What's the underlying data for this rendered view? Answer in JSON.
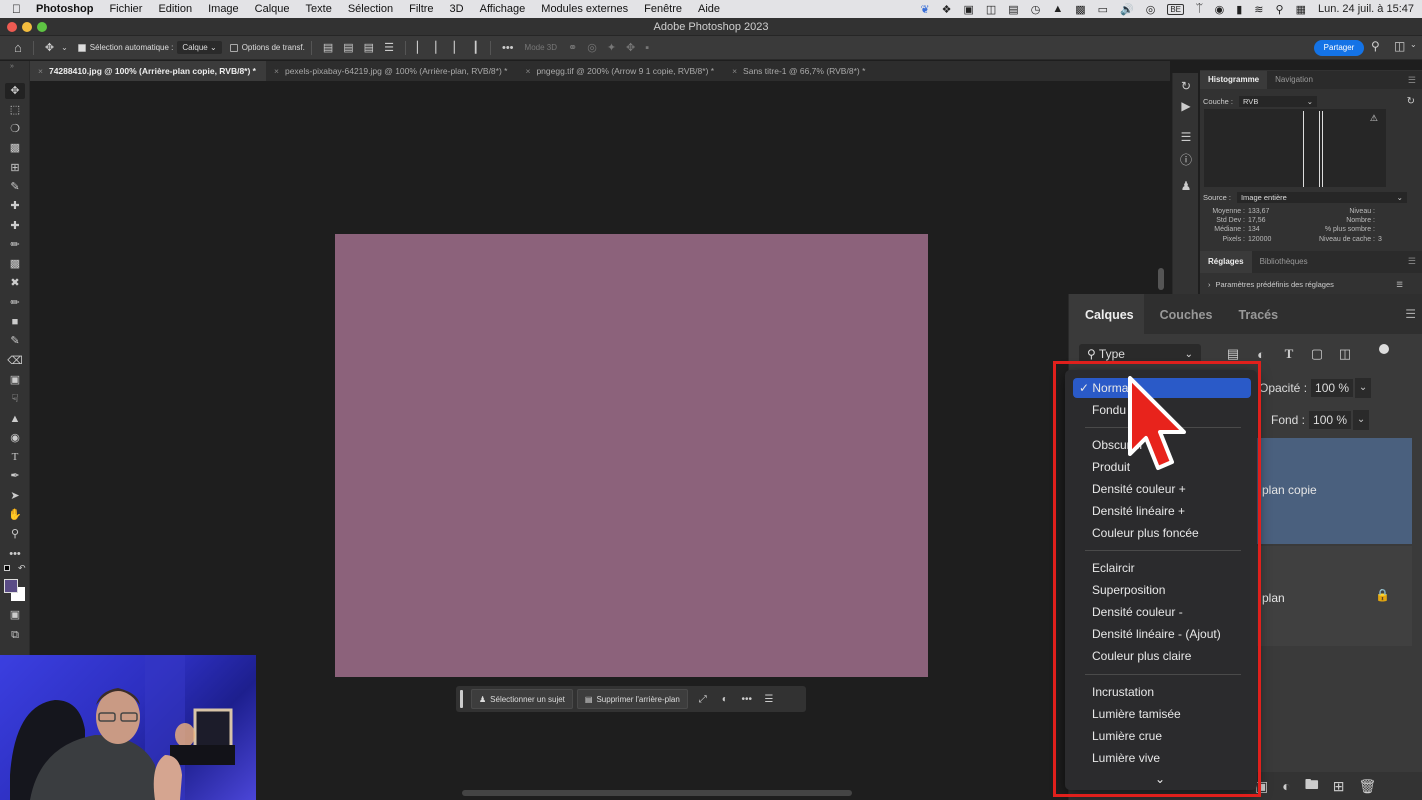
{
  "os_menubar": {
    "app_name": "Photoshop",
    "items": [
      "Fichier",
      "Edition",
      "Image",
      "Calque",
      "Texte",
      "Sélection",
      "Filtre",
      "3D",
      "Affichage",
      "Modules externes",
      "Fenêtre",
      "Aide"
    ],
    "status_icons": [
      "butterfly-icon",
      "dropbox-icon",
      "camera-icon",
      "window-icon",
      "clipboard-icon",
      "clock-icon",
      "binoculars-icon",
      "grid-icon",
      "display-icon",
      "volume-icon",
      "airdrop-icon",
      "keyboard-layout-icon",
      "bluetooth-icon",
      "user-icon",
      "battery-icon",
      "wifi-icon",
      "search-icon",
      "control-center-icon"
    ],
    "keyboard_layout": "BE",
    "datetime": "Lun. 24 juil. à 15:47"
  },
  "window": {
    "title": "Adobe Photoshop 2023",
    "traffic_colors": {
      "close": "#ee5b52",
      "minimize": "#f4bd3e",
      "zoom": "#5ec443"
    }
  },
  "options_bar": {
    "auto_select_label": "Sélection automatique :",
    "auto_select_checked": true,
    "auto_select_target": "Calque",
    "transform_label": "Options de transf.",
    "transform_checked": false,
    "mode_3d_label": "Mode 3D",
    "share_label": "Partager",
    "accent_color": "#1473e6"
  },
  "document_tabs": [
    {
      "label": "74288410.jpg @ 100% (Arrière-plan copie, RVB/8*) *",
      "active": true
    },
    {
      "label": "pexels-pixabay-64219.jpg @ 100% (Arrière-plan, RVB/8*) *",
      "active": false
    },
    {
      "label": "pngegg.tif @ 200% (Arrow 9 1 copie, RVB/8*) *",
      "active": false
    },
    {
      "label": "Sans titre-1 @ 66,7% (RVB/8*) *",
      "active": false
    }
  ],
  "canvas": {
    "fill_color": "#8c627b"
  },
  "task_bar": {
    "select_subject": "Sélectionner un sujet",
    "remove_background": "Supprimer l'arrière-plan"
  },
  "histogram_panel": {
    "tabs": [
      "Histogramme",
      "Navigation"
    ],
    "channel_label": "Couche :",
    "channel_value": "RVB",
    "source_label": "Source :",
    "source_value": "Image entière",
    "stats": {
      "mean_label": "Moyenne :",
      "mean": "133,67",
      "std_label": "Std Dev :",
      "std": "17,56",
      "median_label": "Médiane :",
      "median": "134",
      "pixels_label": "Pixels :",
      "pixels": "120000",
      "level_label": "Niveau :",
      "level": "",
      "count_label": "Nombre :",
      "count": "",
      "percentile_label": "% plus sombre :",
      "percentile": "",
      "cache_label": "Niveau de cache :",
      "cache": "3"
    }
  },
  "adjustments_panel": {
    "tabs": [
      "Réglages",
      "Bibliothèques"
    ],
    "presets_label": "Paramètres prédéfinis des réglages"
  },
  "layers_panel": {
    "tabs": [
      "Calques",
      "Couches",
      "Tracés"
    ],
    "filter_label": "Type",
    "opacity_label": "Opacité :",
    "opacity_value": "100 %",
    "fill_label": "Fond :",
    "fill_value": "100 %",
    "layers": [
      {
        "name": "plan copie",
        "selected": true
      },
      {
        "name": "plan",
        "selected": false,
        "locked": true
      }
    ]
  },
  "blend_menu": {
    "selected": "Normal",
    "groups": [
      [
        "Normal",
        "Fondu"
      ],
      [
        "Obscurcir",
        "Produit",
        "Densité couleur +",
        "Densité linéaire +",
        "Couleur plus foncée"
      ],
      [
        "Eclaircir",
        "Superposition",
        "Densité couleur -",
        "Densité linéaire - (Ajout)",
        "Couleur plus claire"
      ],
      [
        "Incrustation",
        "Lumière tamisée",
        "Lumière crue",
        "Lumière vive"
      ]
    ],
    "visible_items": [
      "Normal",
      "Fondu",
      "Obscurcir",
      "Produit",
      "Densité couleur +",
      "Densité linéaire +",
      "Couleur plus foncée",
      "Eclaircir",
      "Superposition",
      "Densité couleur -",
      "Densité linéaire - (Ajout)",
      "Couleur plus claire",
      "Incrustation",
      "Lumière tamisée",
      "Lumière crue",
      "Lumière vive"
    ],
    "highlight_color": "#2a5ac8",
    "annotation_color": "#e0201c"
  },
  "toolbar": {
    "tools": [
      "move-tool",
      "marquee-tool",
      "lasso-tool",
      "object-select-tool",
      "crop-tool",
      "eyedropper-tool",
      "spot-healing-tool",
      "healing-brush-tool",
      "brush-tool",
      "pattern-tool",
      "content-aware-move-tool",
      "pencil-tool",
      "clone-stamp-tool",
      "history-brush-tool",
      "eraser-tool",
      "gradient-tool",
      "smudge-tool",
      "sharpen-tool",
      "dodge-tool",
      "type-tool",
      "pen-tool",
      "path-select-tool",
      "hand-tool",
      "zoom-tool",
      "more-tools"
    ],
    "foreground_color": "#5a4c86",
    "background_color": "#ffffff"
  }
}
